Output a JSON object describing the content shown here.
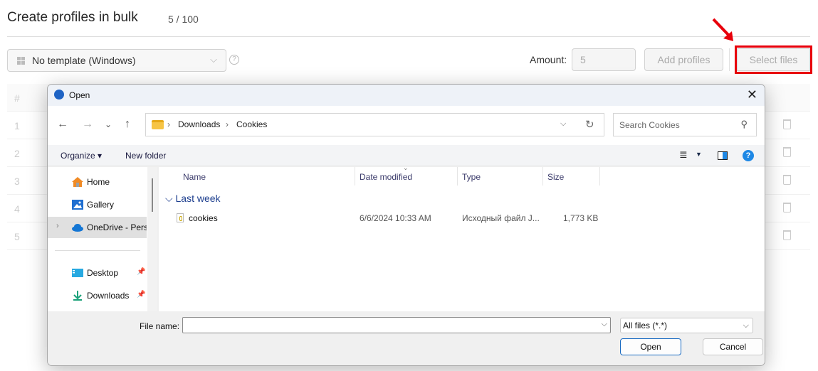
{
  "page": {
    "title": "Create profiles in bulk",
    "count": "5 / 100",
    "template_select": {
      "value": "No template (Windows)",
      "icon": "windows-icon"
    },
    "help_icon": "question-circle-icon",
    "amount_label": "Amount:",
    "amount_value": "5",
    "add_profiles_label": "Add profiles",
    "select_files_label": "Select files",
    "highlight_color": "#e8000b",
    "table": {
      "header": "#",
      "rows": [
        "1",
        "2",
        "3",
        "4",
        "5"
      ]
    }
  },
  "dialog": {
    "title": "Open",
    "close_icon": "close-icon",
    "nav": {
      "back": "←",
      "forward": "→",
      "recent": "⌄",
      "up": "↑"
    },
    "breadcrumb": [
      "Downloads",
      "Cookies"
    ],
    "search_placeholder": "Search Cookies",
    "toolbar": {
      "organize": "Organize ▾",
      "new_folder": "New folder"
    },
    "sidebar": [
      {
        "label": "Home",
        "icon": "home-icon"
      },
      {
        "label": "Gallery",
        "icon": "gallery-icon"
      },
      {
        "label": "OneDrive - Personal",
        "icon": "onedrive-icon",
        "selected": true
      },
      {
        "label": "Desktop",
        "icon": "desktop-icon",
        "pinned": true
      },
      {
        "label": "Downloads",
        "icon": "downloads-icon",
        "pinned": true
      }
    ],
    "columns": [
      "Name",
      "Date modified",
      "Type",
      "Size"
    ],
    "group": "Last week",
    "files": [
      {
        "name": "cookies",
        "date": "6/6/2024 10:33 AM",
        "type": "Исходный файл J...",
        "size": "1,773 KB"
      }
    ],
    "file_name_label": "File name:",
    "file_name_value": "",
    "file_type": "All files (*.*)",
    "open_label": "Open",
    "cancel_label": "Cancel"
  }
}
